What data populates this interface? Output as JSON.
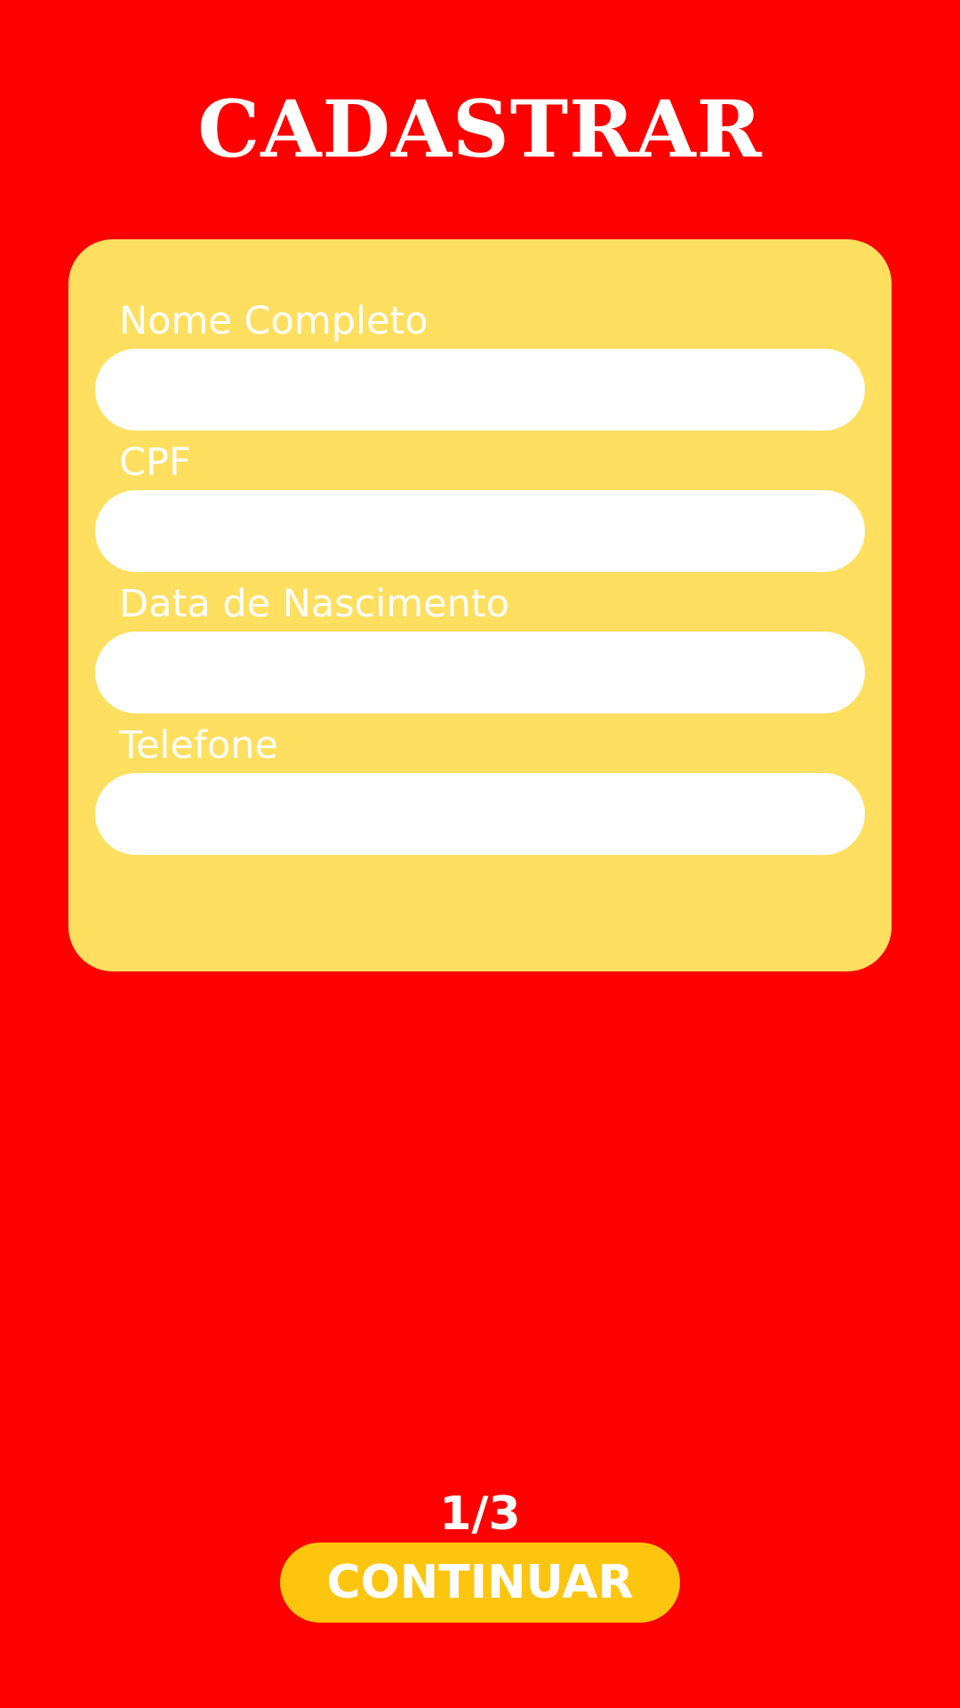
{
  "page": {
    "title": "CADASTRAR",
    "step": "1/3",
    "continue_label": "CONTINUAR"
  },
  "form": {
    "fields": [
      {
        "label": "Nome Completo",
        "value": ""
      },
      {
        "label": "CPF",
        "value": ""
      },
      {
        "label": "Data de Nascimento",
        "value": ""
      },
      {
        "label": "Telefone",
        "value": ""
      }
    ]
  },
  "colors": {
    "background": "#ff0000",
    "card": "#ffdf5f",
    "input": "#ffffff",
    "button": "#fec50f",
    "text": "#ffffff"
  }
}
